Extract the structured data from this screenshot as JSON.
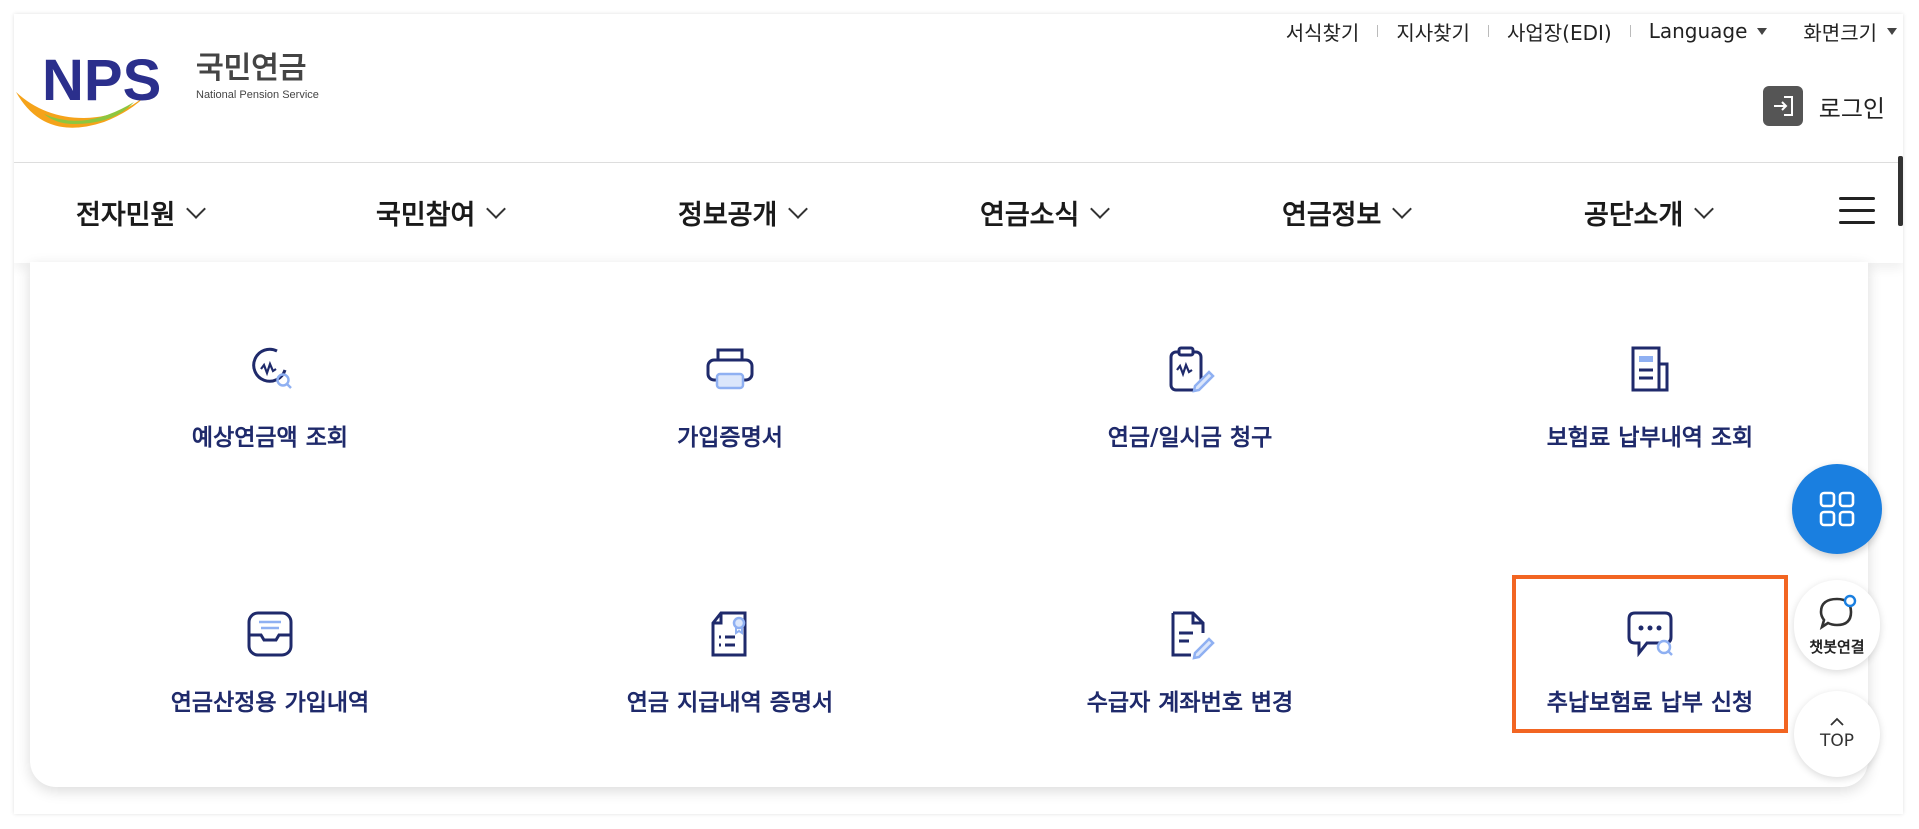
{
  "logo": {
    "letters": "NPS",
    "korean_name": "국민연금",
    "english_name": "National Pension Service"
  },
  "utility": {
    "items": [
      {
        "label": "서식찾기"
      },
      {
        "label": "지사찾기"
      },
      {
        "label": "사업장(EDI)"
      },
      {
        "label": "Language"
      },
      {
        "label": "화면크기"
      }
    ]
  },
  "login": {
    "label": "로그인",
    "icon": "login-icon"
  },
  "nav": {
    "items": [
      {
        "label": "전자민원"
      },
      {
        "label": "국민참여"
      },
      {
        "label": "정보공개"
      },
      {
        "label": "연금소식"
      },
      {
        "label": "연금정보"
      },
      {
        "label": "공단소개"
      }
    ]
  },
  "menu": {
    "tiles": [
      {
        "label": "예상연금액 조회",
        "icon": "pension-search-icon"
      },
      {
        "label": "가입증명서",
        "icon": "printer-icon"
      },
      {
        "label": "연금/일시금 청구",
        "icon": "clipboard-edit-icon"
      },
      {
        "label": "보험료 납부내역 조회",
        "icon": "document-icon"
      },
      {
        "label": "연금산정용 가입내역",
        "icon": "inbox-icon"
      },
      {
        "label": "연금 지급내역 증명서",
        "icon": "certificate-icon"
      },
      {
        "label": "수급자 계좌번호 변경",
        "icon": "document-edit-icon"
      },
      {
        "label": "추납보험료 납부 신청",
        "icon": "chat-search-icon"
      }
    ]
  },
  "floating": {
    "menu_icon": "grid-icon",
    "chatbot_label": "챗봇연결",
    "top_label": "TOP"
  },
  "colors": {
    "brand_navy": "#1f2a6b",
    "accent_blue": "#1a7fe0",
    "highlight": "#f26522"
  }
}
